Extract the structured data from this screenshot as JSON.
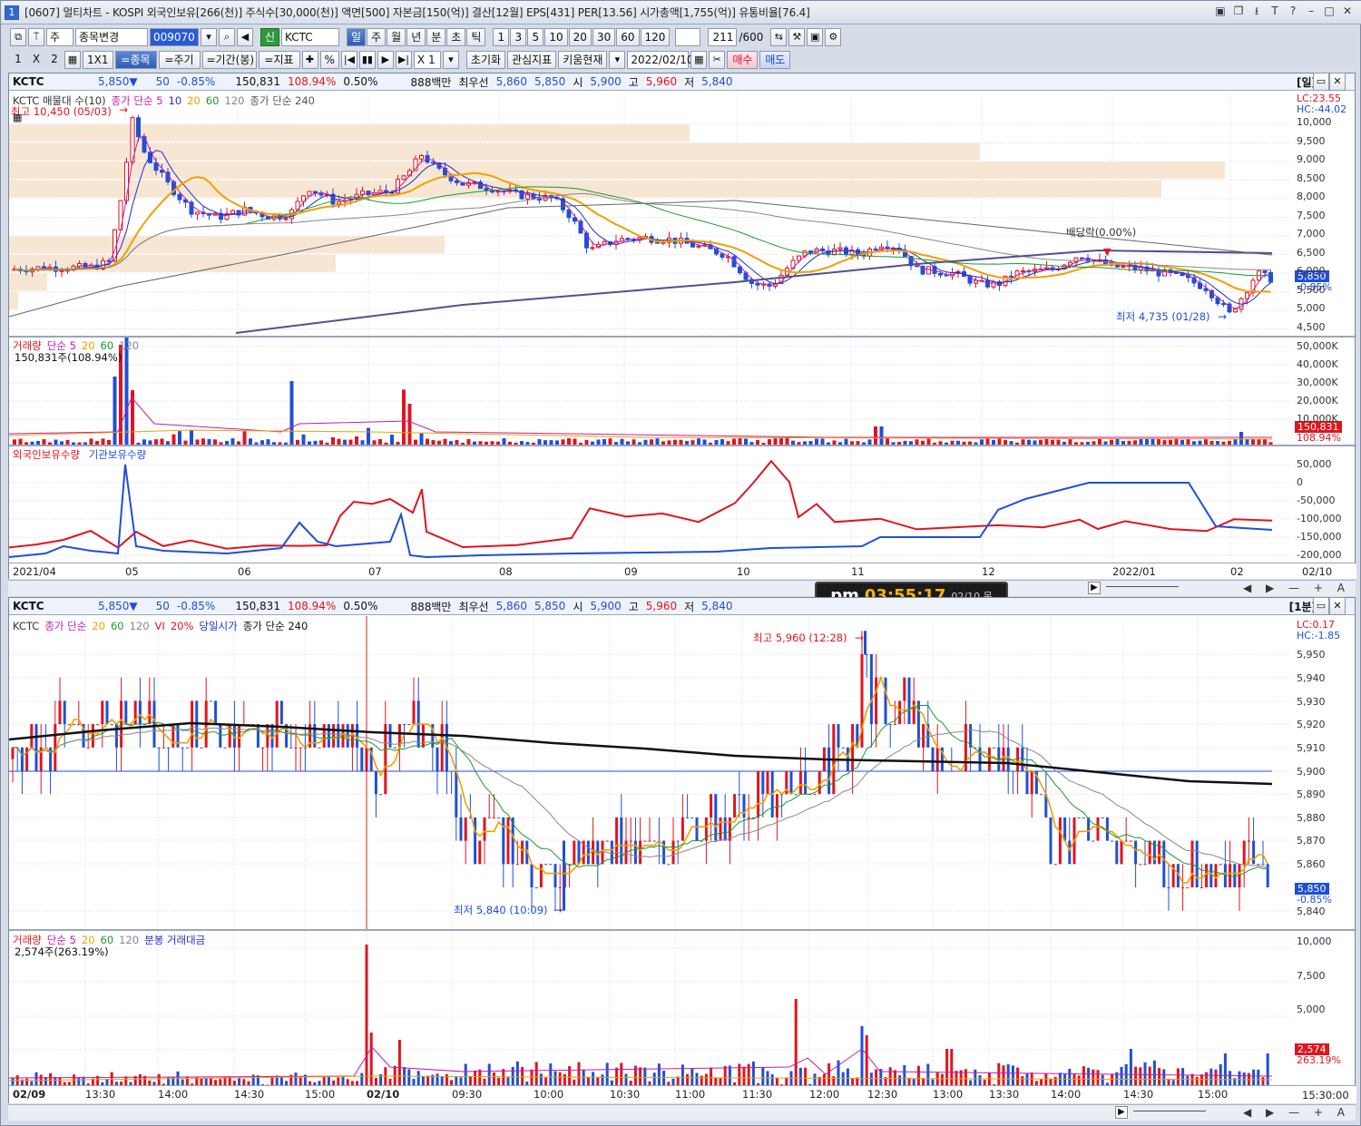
{
  "title": "[0607] 멀티차트 - KOSPI 외국인보유[266(천)] 주식수[30,000(천)] 액면[500] 자본금[150(억)] 결산[12월] EPS[431] PER[13.56] 시가총액[1,755(억)] 유통비율[76.4]",
  "window_number": "1",
  "window_controls": [
    "▣",
    "❐",
    "⭳",
    "T",
    "?",
    "–",
    "□",
    "✕"
  ],
  "toolbar1": {
    "period_sel": "주",
    "stock_change": "종목변경",
    "code": "009070",
    "market_badge": "신",
    "stock_name": "KCTC",
    "periods": [
      "일",
      "주",
      "월",
      "년",
      "분",
      "초",
      "틱"
    ],
    "intervals": [
      "1",
      "3",
      "5",
      "10",
      "20",
      "30",
      "60",
      "120"
    ],
    "count_value": "211",
    "count_total": "/600"
  },
  "toolbar2": {
    "layout": [
      "1",
      "X",
      "2"
    ],
    "one_by_one": "1X1",
    "btn_stock": "=종목",
    "btn_cycle": "=주기",
    "btn_period": "=기간(봉)",
    "btn_indicator": "=지표",
    "percent": "%",
    "multiplier": "X 1",
    "btn_reset": "초기화",
    "btn_interest": "관심지표",
    "btn_kiwoom": "키움현재",
    "date": "2022/02/10",
    "btn_buy": "매수",
    "btn_sell": "매도"
  },
  "info": {
    "code": "KCTC",
    "price": "5,850",
    "arrow": "▼",
    "change": "50",
    "change_pct": "-0.85%",
    "volume": "150,831",
    "vol_ratio": "108.94%",
    "turnover": "0.50%",
    "amount": "888백만",
    "priority_label": "최우선",
    "ask": "5,860",
    "bid": "5,850",
    "open_label": "시",
    "open": "5,900",
    "high_label": "고",
    "high": "5,960",
    "low_label": "저",
    "low": "5,840"
  },
  "daily": {
    "period_tag": "[일]",
    "legend_price": [
      "KCTC 매물대 수(10)",
      "종가 단순 5",
      "10",
      "20",
      "60",
      "120",
      "종가 단순 240"
    ],
    "lc": "LC:23.55",
    "hc": "HC:-44.02",
    "high_note": "최고 10,450 (05/03)",
    "low_note": "최저 4,735 (01/28)",
    "div_note": "배당락(0.00%)",
    "price_ticks": [
      "10,000",
      "9,500",
      "9,000",
      "8,500",
      "8,000",
      "7,500",
      "7,000",
      "6,500",
      "6,000",
      "5,500",
      "5,000",
      "4,500"
    ],
    "price_tag": "5,850",
    "price_tag_pct": "-0.85%",
    "legend_vol": [
      "거래량",
      "단순 5",
      "20",
      "60",
      "120"
    ],
    "vol_readout": "150,831주(108.94%)",
    "vol_ticks": [
      "50,000K",
      "40,000K",
      "30,000K",
      "20,000K",
      "10,000K"
    ],
    "vol_tag": "150,831",
    "vol_tag_pct": "108.94%",
    "legend_hold": [
      "외국인보유수량",
      "기관보유수량"
    ],
    "hold_ticks": [
      "50,000",
      "0",
      "-50,000",
      "-100,000",
      "-150,000",
      "-200,000"
    ],
    "x_labels": [
      "2021/04",
      "05",
      "06",
      "07",
      "08",
      "09",
      "10",
      "11",
      "12",
      "2022/01",
      "02"
    ],
    "x_right": "02/10"
  },
  "minute": {
    "period_tag": "[1분]",
    "legend_price": [
      "KCTC",
      "종가 단순",
      "20",
      "60",
      "120",
      "VI",
      "20%",
      "당일시가",
      "종가 단순 240"
    ],
    "lc": "LC:0.17",
    "hc": "HC:-1.85",
    "high_note": "최고 5,960 (12:28)",
    "low_note": "최저 5,840 (10:09)",
    "price_ticks": [
      "5,950",
      "5,940",
      "5,930",
      "5,920",
      "5,910",
      "5,900",
      "5,890",
      "5,880",
      "5,870",
      "5,860",
      "5,840"
    ],
    "price_tag": "5,850",
    "price_tag_pct": "-0.85%",
    "legend_vol": [
      "거래량",
      "단순 5",
      "20",
      "60",
      "120",
      "분봉 거래대금"
    ],
    "vol_readout": "2,574주(263.19%)",
    "vol_ticks": [
      "10,000",
      "7,500",
      "5,000"
    ],
    "vol_tag": "2,574",
    "vol_tag_pct": "263.19%",
    "x_labels": [
      "02/09",
      "13:30",
      "14:00",
      "14:30",
      "15:00",
      "02/10",
      "09:30",
      "10:00",
      "10:30",
      "11:00",
      "11:30",
      "12:00",
      "12:30",
      "13:00",
      "13:30",
      "14:00",
      "14:30",
      "15:00"
    ],
    "x_right": "15:30:00"
  },
  "clock": {
    "ampm": "pm",
    "time": "03:55:17",
    "date": "02/10 목"
  },
  "colors": {
    "up": "#e0141e",
    "down": "#1f4fd8",
    "ma5": "#c21db0",
    "ma10": "#2030c8",
    "ma20": "#f0a000",
    "ma60": "#1c9a2c",
    "ma120": "#888888",
    "ma240": "#554f8c",
    "volume_profile": "#f6e6d3"
  },
  "scroll_controls": "◀ ▶ — + A"
}
